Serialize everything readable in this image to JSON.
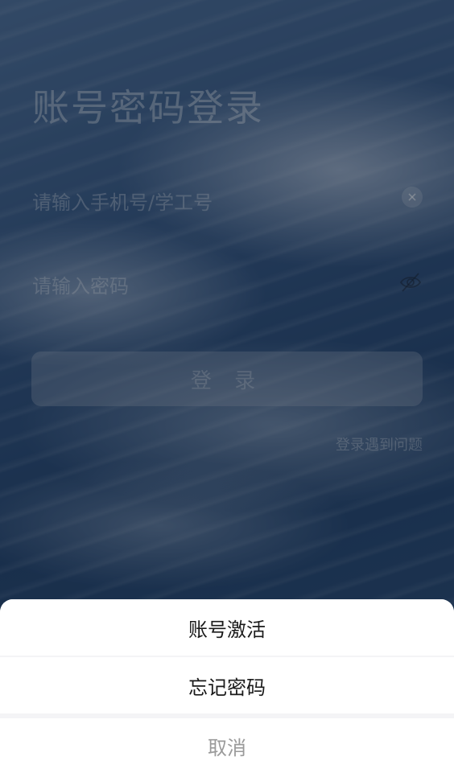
{
  "login": {
    "title": "账号密码登录",
    "phone_placeholder": "请输入手机号/学工号",
    "password_placeholder": "请输入密码",
    "login_button": "登 录",
    "help_link": "登录遇到问题"
  },
  "action_sheet": {
    "items": [
      {
        "label": "账号激活"
      },
      {
        "label": "忘记密码"
      }
    ],
    "cancel": "取消"
  },
  "icons": {
    "clear": "clear-icon",
    "password_visibility": "eye-off-icon"
  },
  "colors": {
    "overlay": "#1f3a5c",
    "sheet_bg": "#ffffff",
    "cancel_text": "#9a9a9a"
  }
}
